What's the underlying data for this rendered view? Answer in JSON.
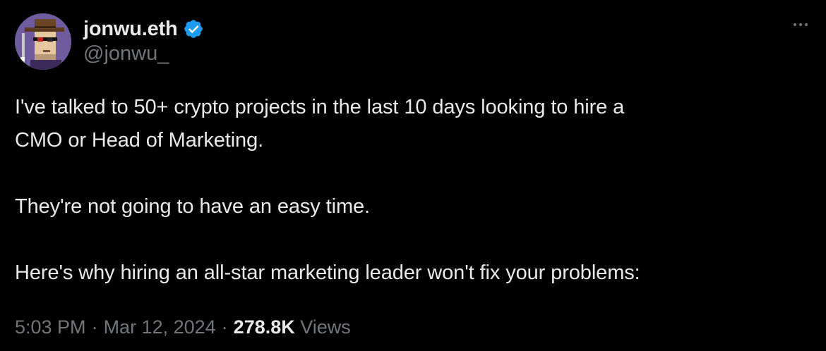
{
  "author": {
    "display_name": "jonwu.eth",
    "handle": "@jonwu_",
    "verified": true
  },
  "tweet": {
    "paragraphs": [
      "I've talked to 50+ crypto projects in the last 10 days looking to hire a",
      "CMO or Head of Marketing.",
      "",
      "They're not going to have an easy time.",
      "",
      "Here's why hiring an all-star marketing leader won't fix your problems:"
    ]
  },
  "meta": {
    "time": "5:03 PM",
    "separator": "·",
    "date": "Mar 12, 2024",
    "views_count": "278.8K",
    "views_label": "Views"
  },
  "icons": {
    "verified": "verified-badge-icon",
    "more": "more-options-icon"
  },
  "colors": {
    "background": "#000000",
    "text_primary": "#e7e9ea",
    "text_secondary": "#71767b",
    "verified_blue": "#1d9bf0"
  }
}
